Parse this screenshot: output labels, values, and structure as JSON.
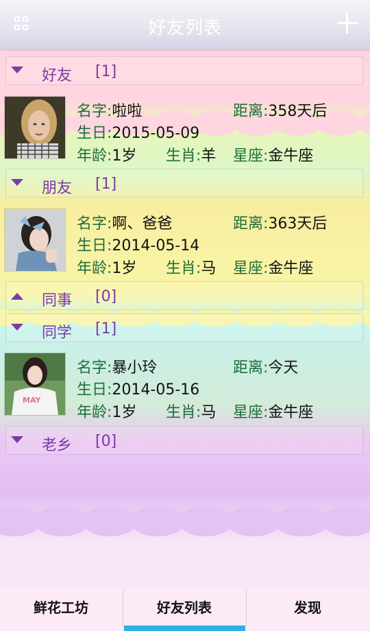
{
  "header": {
    "title": "好友列表"
  },
  "colors": {
    "header_text": "#ffffff",
    "group_text": "#7b3aa6",
    "field_label": "#1f6e3a",
    "tab_indicator": "#2bb0e6"
  },
  "icons": {
    "menu": "grid-icon",
    "add": "plus-icon"
  },
  "labels": {
    "name": "名字:",
    "distance": "距离:",
    "birthday": "生日:",
    "age": "年龄:",
    "zodiac": "生肖:",
    "constellation": "星座:"
  },
  "groups": [
    {
      "name": "好友",
      "count": "[1]",
      "expanded": true
    },
    {
      "name": "朋友",
      "count": "[1]",
      "expanded": true
    },
    {
      "name": "同事",
      "count": "[0]",
      "expanded": false
    },
    {
      "name": "同学",
      "count": "[1]",
      "expanded": true
    },
    {
      "name": "老乡",
      "count": "[0]",
      "expanded": true
    }
  ],
  "friends": [
    {
      "name": "啦啦",
      "distance": "358天后",
      "birthday": "2015-05-09",
      "age": "1岁",
      "zodiac": "羊",
      "constellation": "金牛座"
    },
    {
      "name": "啊、爸爸",
      "distance": "363天后",
      "birthday": "2014-05-14",
      "age": "1岁",
      "zodiac": "马",
      "constellation": "金牛座"
    },
    {
      "name": "暴小玲",
      "distance": "今天",
      "birthday": "2014-05-16",
      "age": "1岁",
      "zodiac": "马",
      "constellation": "金牛座"
    }
  ],
  "avatar_shirt_text": "MAY",
  "tabs": [
    {
      "label": "鲜花工坊",
      "selected": false
    },
    {
      "label": "好友列表",
      "selected": true
    },
    {
      "label": "发现",
      "selected": false
    }
  ]
}
